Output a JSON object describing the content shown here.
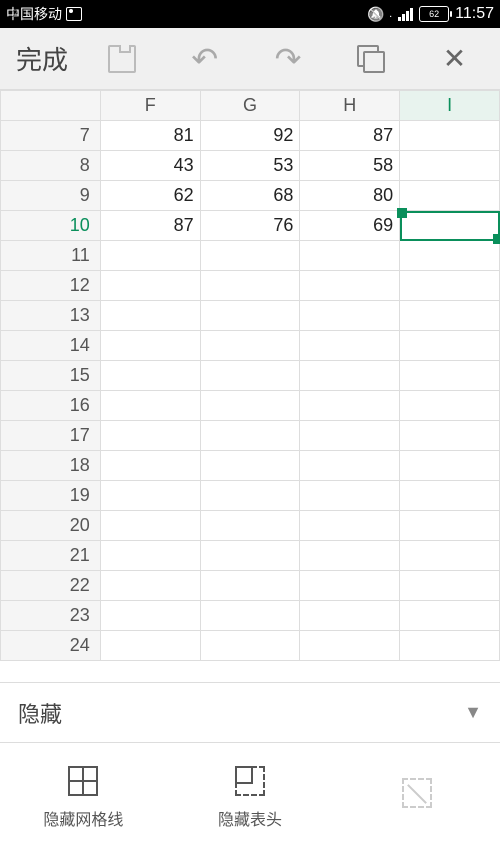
{
  "status": {
    "carrier": "中国移动",
    "battery": "62",
    "time": "11:57"
  },
  "toolbar": {
    "done": "完成",
    "copy_count": "2"
  },
  "sheet": {
    "cols": [
      "F",
      "G",
      "H",
      "I"
    ],
    "rows": [
      "7",
      "8",
      "9",
      "10",
      "11",
      "12",
      "13",
      "14",
      "15",
      "16",
      "17",
      "18",
      "19",
      "20",
      "21",
      "22",
      "23",
      "24"
    ],
    "data": {
      "7": {
        "F": "81",
        "G": "92",
        "H": "87"
      },
      "8": {
        "F": "43",
        "G": "53",
        "H": "58"
      },
      "9": {
        "F": "62",
        "G": "68",
        "H": "80"
      },
      "10": {
        "F": "87",
        "G": "76",
        "H": "69"
      }
    },
    "active_row": "10",
    "active_col": "I"
  },
  "panel": {
    "hide_label": "隐藏"
  },
  "bottom": {
    "grid": "隐藏网格线",
    "header": "隐藏表头",
    "cut": ""
  }
}
